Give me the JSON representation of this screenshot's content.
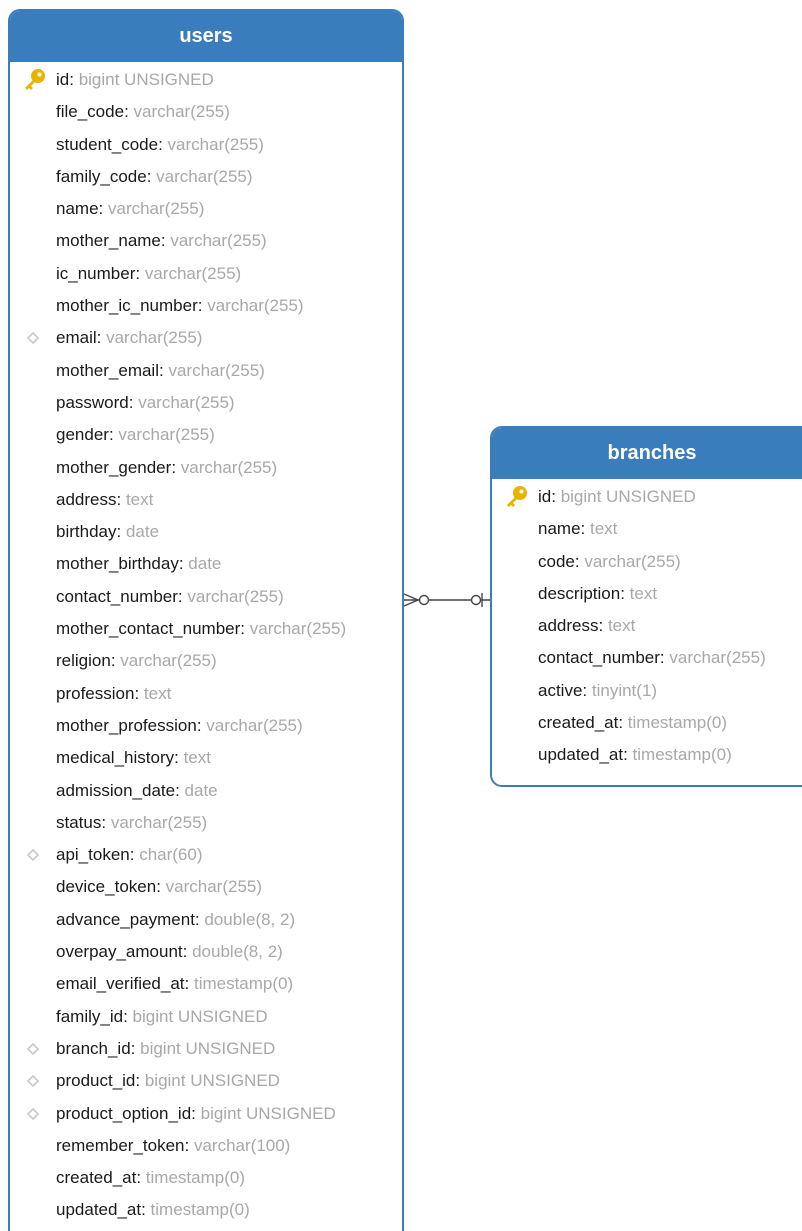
{
  "tables": [
    {
      "id": "users",
      "title": "users",
      "fields": [
        {
          "name": "id",
          "type": "bigint UNSIGNED",
          "marker": "key"
        },
        {
          "name": "file_code",
          "type": "varchar(255)",
          "marker": "none"
        },
        {
          "name": "student_code",
          "type": "varchar(255)",
          "marker": "none"
        },
        {
          "name": "family_code",
          "type": "varchar(255)",
          "marker": "none"
        },
        {
          "name": "name",
          "type": "varchar(255)",
          "marker": "none"
        },
        {
          "name": "mother_name",
          "type": "varchar(255)",
          "marker": "none"
        },
        {
          "name": "ic_number",
          "type": "varchar(255)",
          "marker": "none"
        },
        {
          "name": "mother_ic_number",
          "type": "varchar(255)",
          "marker": "none"
        },
        {
          "name": "email",
          "type": "varchar(255)",
          "marker": "index"
        },
        {
          "name": "mother_email",
          "type": "varchar(255)",
          "marker": "none"
        },
        {
          "name": "password",
          "type": "varchar(255)",
          "marker": "none"
        },
        {
          "name": "gender",
          "type": "varchar(255)",
          "marker": "none"
        },
        {
          "name": "mother_gender",
          "type": "varchar(255)",
          "marker": "none"
        },
        {
          "name": "address",
          "type": "text",
          "marker": "none"
        },
        {
          "name": "birthday",
          "type": "date",
          "marker": "none"
        },
        {
          "name": "mother_birthday",
          "type": "date",
          "marker": "none"
        },
        {
          "name": "contact_number",
          "type": "varchar(255)",
          "marker": "none"
        },
        {
          "name": "mother_contact_number",
          "type": "varchar(255)",
          "marker": "none"
        },
        {
          "name": "religion",
          "type": "varchar(255)",
          "marker": "none"
        },
        {
          "name": "profession",
          "type": "text",
          "marker": "none"
        },
        {
          "name": "mother_profession",
          "type": "varchar(255)",
          "marker": "none"
        },
        {
          "name": "medical_history",
          "type": "text",
          "marker": "none"
        },
        {
          "name": "admission_date",
          "type": "date",
          "marker": "none"
        },
        {
          "name": "status",
          "type": "varchar(255)",
          "marker": "none"
        },
        {
          "name": "api_token",
          "type": "char(60)",
          "marker": "index"
        },
        {
          "name": "device_token",
          "type": "varchar(255)",
          "marker": "none"
        },
        {
          "name": "advance_payment",
          "type": "double(8, 2)",
          "marker": "none"
        },
        {
          "name": "overpay_amount",
          "type": "double(8, 2)",
          "marker": "none"
        },
        {
          "name": "email_verified_at",
          "type": "timestamp(0)",
          "marker": "none"
        },
        {
          "name": "family_id",
          "type": "bigint UNSIGNED",
          "marker": "none"
        },
        {
          "name": "branch_id",
          "type": "bigint UNSIGNED",
          "marker": "index"
        },
        {
          "name": "product_id",
          "type": "bigint UNSIGNED",
          "marker": "index"
        },
        {
          "name": "product_option_id",
          "type": "bigint UNSIGNED",
          "marker": "index"
        },
        {
          "name": "remember_token",
          "type": "varchar(100)",
          "marker": "none"
        },
        {
          "name": "created_at",
          "type": "timestamp(0)",
          "marker": "none"
        },
        {
          "name": "updated_at",
          "type": "timestamp(0)",
          "marker": "none"
        }
      ]
    },
    {
      "id": "branches",
      "title": "branches",
      "fields": [
        {
          "name": "id",
          "type": "bigint UNSIGNED",
          "marker": "key"
        },
        {
          "name": "name",
          "type": "text",
          "marker": "none"
        },
        {
          "name": "code",
          "type": "varchar(255)",
          "marker": "none"
        },
        {
          "name": "description",
          "type": "text",
          "marker": "none"
        },
        {
          "name": "address",
          "type": "text",
          "marker": "none"
        },
        {
          "name": "contact_number",
          "type": "varchar(255)",
          "marker": "none"
        },
        {
          "name": "active",
          "type": "tinyint(1)",
          "marker": "none"
        },
        {
          "name": "created_at",
          "type": "timestamp(0)",
          "marker": "none"
        },
        {
          "name": "updated_at",
          "type": "timestamp(0)",
          "marker": "none"
        }
      ]
    }
  ],
  "relationships": [
    {
      "from": "users.branch_id",
      "to": "branches.id",
      "from_cardinality": "zero-or-many",
      "to_cardinality": "zero-or-one"
    }
  ],
  "colors": {
    "header": "#3a7dbd",
    "field_name": "#1a1a1a",
    "field_type": "#a8a8a8",
    "key_icon": "#e8b400",
    "index_icon": "#c8c8c8"
  }
}
